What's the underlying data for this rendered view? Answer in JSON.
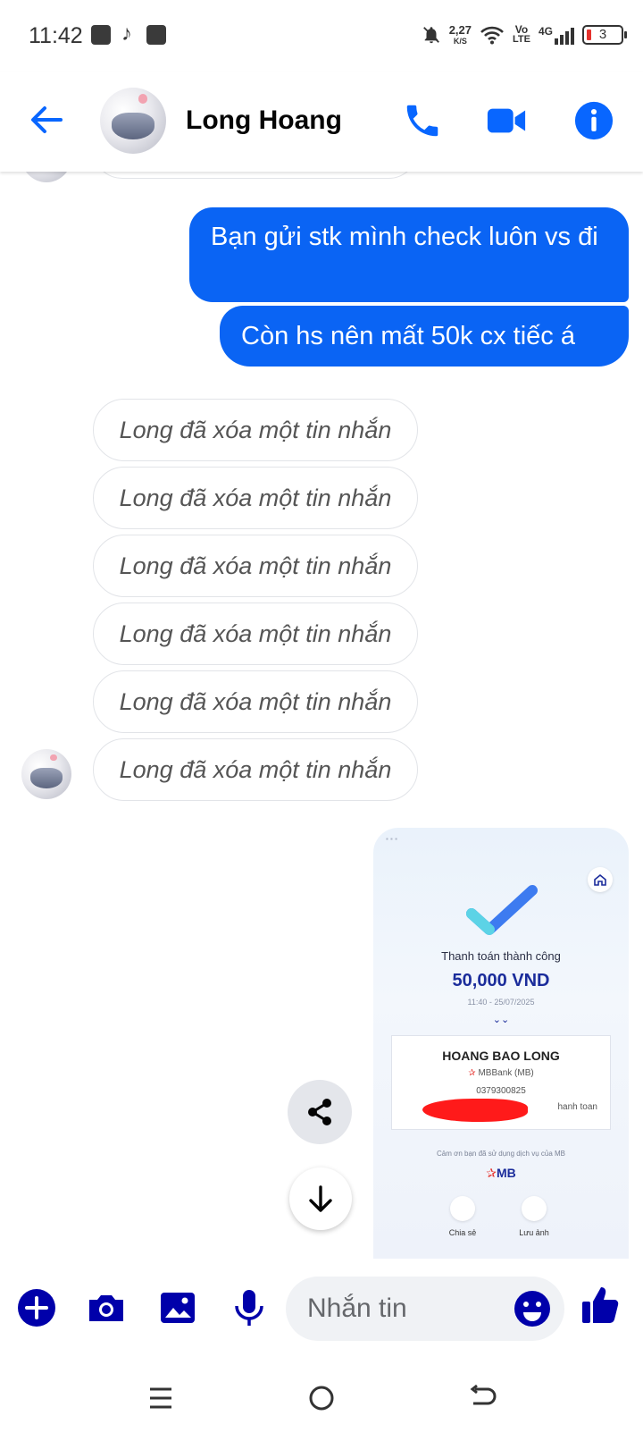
{
  "status_bar": {
    "time": "11:42",
    "net_speed_value": "2,27",
    "net_speed_unit": "K/S",
    "volte_top": "Vo",
    "volte_bottom": "LTE",
    "network": "4G",
    "battery": "3"
  },
  "header": {
    "contact_name": "Long Hoang"
  },
  "messages": {
    "outgoing": [
      "Bạn gửi stk mình check luôn vs đi",
      "Còn hs nên mất 50k cx tiếc á"
    ],
    "deleted_text": "Long đã xóa một tin nhắn"
  },
  "receipt": {
    "title": "Thanh toán thành công",
    "amount": "50,000 VND",
    "datetime": "11:40 - 25/07/2025",
    "recipient_name": "HOANG BAO LONG",
    "bank": "MBBank (MB)",
    "account": "0379300825",
    "description_tail": "hanh toan",
    "thanks": "Cảm ơn bạn đã sử dụng dịch vụ của MB",
    "brand": "MB",
    "share_label": "Chia sẻ",
    "save_label": "Lưu ảnh"
  },
  "composer": {
    "placeholder": "Nhắn tin"
  },
  "colors": {
    "accent": "#0a64f4",
    "icon_blue": "#0866ff",
    "composer_icon": "#0000aa"
  }
}
